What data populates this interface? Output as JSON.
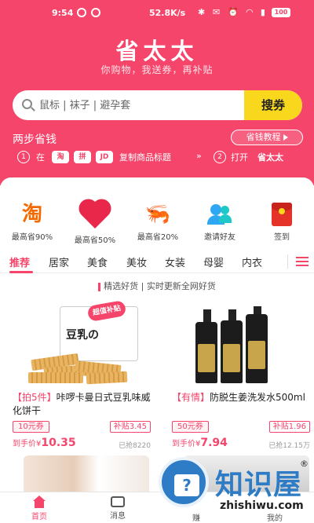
{
  "status_bar": {
    "time": "9:54",
    "net_speed": "52.8K/s",
    "battery": "100"
  },
  "app": {
    "logo": "省太太",
    "slogan": "你购物，我送券，再补贴"
  },
  "search": {
    "placeholder": "鼠标 | 袜子 | 避孕套",
    "button": "搜券"
  },
  "steps": {
    "title": "两步省钱",
    "tutorial_button": "省钱教程",
    "step1_num": "1",
    "step1_at": "在",
    "step1_action": "复制商品标题",
    "arrow": "»",
    "step2_num": "2",
    "step2_action": "打开",
    "step2_app": "省太太",
    "app_tb": "淘",
    "app_pdd": "拼",
    "app_jd": "JD"
  },
  "quick_entries": [
    {
      "label": "最高省90%",
      "icon": "taobao-icon",
      "glyph": "淘"
    },
    {
      "label": "最高省50%",
      "icon": "pinduoduo-icon"
    },
    {
      "label": "最高省20%",
      "icon": "jd-icon",
      "glyph": "🦐"
    },
    {
      "label": "邀请好友",
      "icon": "invite-icon"
    },
    {
      "label": "签到",
      "icon": "red-packet-icon"
    }
  ],
  "tabs": [
    "推荐",
    "居家",
    "美食",
    "美妆",
    "女装",
    "母婴",
    "内衣"
  ],
  "active_tab": "推荐",
  "picks": {
    "title": "精选好货",
    "subtitle": "实时更新全网好货"
  },
  "products": [
    {
      "tag": "【拍5件】",
      "title": "咔啰卡曼日式豆乳味威化饼干",
      "coupon": "10元券",
      "subsidy": "补贴3.45",
      "price_label": "到手价¥",
      "price": "10.35",
      "sold": "已抢8220",
      "img_text": "豆乳の",
      "img_badge": "超值补贴"
    },
    {
      "tag": "【有情】",
      "title": "防脱生姜洗发水500ml",
      "coupon": "50元券",
      "subsidy": "补贴1.96",
      "price_label": "到手价¥",
      "price": "7.94",
      "sold": "已抢12.15万"
    }
  ],
  "bottom_nav": [
    {
      "label": "首页",
      "icon": "home-icon"
    },
    {
      "label": "消息",
      "icon": "message-icon"
    },
    {
      "label": "赚",
      "icon": "earn-icon"
    },
    {
      "label": "我的",
      "icon": "profile-icon"
    }
  ],
  "watermark": {
    "text": "知识屋",
    "domain": "zhishiwu.com",
    "reg": "®",
    "badge": "?"
  },
  "colors": {
    "brand": "#f5456b",
    "search_button": "#f9d71c",
    "watermark": "#2d7cc5"
  }
}
